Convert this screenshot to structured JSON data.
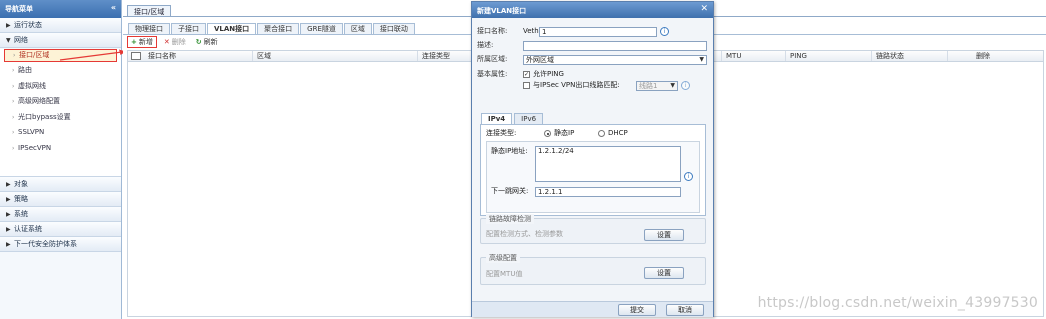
{
  "sidebar": {
    "title": "导航菜单",
    "collapse_icon": "double-chevron-left-icon",
    "categories_top": [
      {
        "label": "运行状态",
        "expanded": false
      },
      {
        "label": "网络",
        "expanded": true
      }
    ],
    "network_items": [
      {
        "label": "接口/区域",
        "active": true
      },
      {
        "label": "路由"
      },
      {
        "label": "虚拟网线"
      },
      {
        "label": "高级网络配置"
      },
      {
        "label": "光口bypass设置"
      },
      {
        "label": "SSLVPN"
      },
      {
        "label": "IPSecVPN"
      }
    ],
    "categories_bottom": [
      {
        "label": "对象"
      },
      {
        "label": "策略"
      },
      {
        "label": "系统"
      },
      {
        "label": "认证系统"
      },
      {
        "label": "下一代安全防护体系"
      }
    ]
  },
  "main": {
    "page_tab": "接口/区域",
    "subtabs": [
      "物理接口",
      "子接口",
      "VLAN接口",
      "聚合接口",
      "GRE隧道",
      "区域",
      "接口联动"
    ],
    "active_subtab": "VLAN接口",
    "toolbar": {
      "new_label": "新增",
      "delete_label": "删除",
      "refresh_label": "刷新"
    },
    "columns": [
      "接口名称",
      "区域",
      "连接类型",
      "MTU",
      "PING",
      "链路状态",
      "删除"
    ]
  },
  "dialog": {
    "title": "新建VLAN接口",
    "fields": {
      "name_label": "接口名称:",
      "name_prefix": "Veth.",
      "name_value": "1",
      "desc_label": "描述:",
      "desc_value": "",
      "zone_label": "所属区域:",
      "zone_value": "外网区域",
      "basic_label": "基本属性:",
      "allow_ping_label": "允许PING",
      "ipsec_label": "与IPSec VPN出口线路匹配:",
      "line_value": "线路1"
    },
    "tabs": [
      "IPv4",
      "IPv6"
    ],
    "active_tab": "IPv4",
    "ipv4": {
      "conn_type_label": "连接类型:",
      "static_ip_label": "静态IP",
      "dhcp_label": "DHCP",
      "static_ip_addr_label": "静态IP地址:",
      "static_ip_addr_value": "1.2.1.2/24",
      "gateway_label": "下一跳网关:",
      "gateway_value": "1.2.1.1"
    },
    "link_detect": {
      "title": "链路故障检测",
      "desc": "配置检测方式、检测参数",
      "button": "设置"
    },
    "advanced": {
      "title": "高级配置",
      "desc": "配置MTU值",
      "button": "设置"
    },
    "footer": {
      "submit": "提交",
      "cancel": "取消"
    }
  },
  "watermark": "https://blog.csdn.net/weixin_43997530",
  "colors": {
    "highlight_red": "#e53935",
    "header_blue": "#3b6fb0"
  }
}
